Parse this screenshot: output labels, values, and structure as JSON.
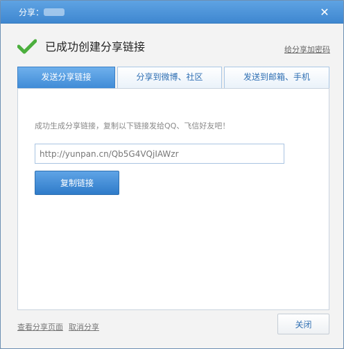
{
  "window": {
    "title": "分享：",
    "close_symbol": "✕",
    "close_icon": "close-icon"
  },
  "header": {
    "status_icon": "checkmark-icon",
    "status_color": "#4caf3e",
    "heading": "已成功创建分享链接",
    "password_link": "给分享加密码"
  },
  "tabs": [
    {
      "label": "发送分享链接",
      "active": true
    },
    {
      "label": "分享到微博、社区",
      "active": false
    },
    {
      "label": "发送到邮箱、手机",
      "active": false
    }
  ],
  "panel": {
    "hint": "成功生成分享链接，复制以下链接发给QQ、飞信好友吧！",
    "link_value": "http://yunpan.cn/Qb5G4VQjIAWzr",
    "copy_button": "复制链接"
  },
  "footer": {
    "view_page_link": "查看分享页面",
    "cancel_share_link": "取消分享",
    "close_button": "关闭"
  },
  "colors": {
    "titlebar": "#4a93da",
    "accent": "#3e8ad6",
    "tab_text": "#2f6fb3"
  }
}
